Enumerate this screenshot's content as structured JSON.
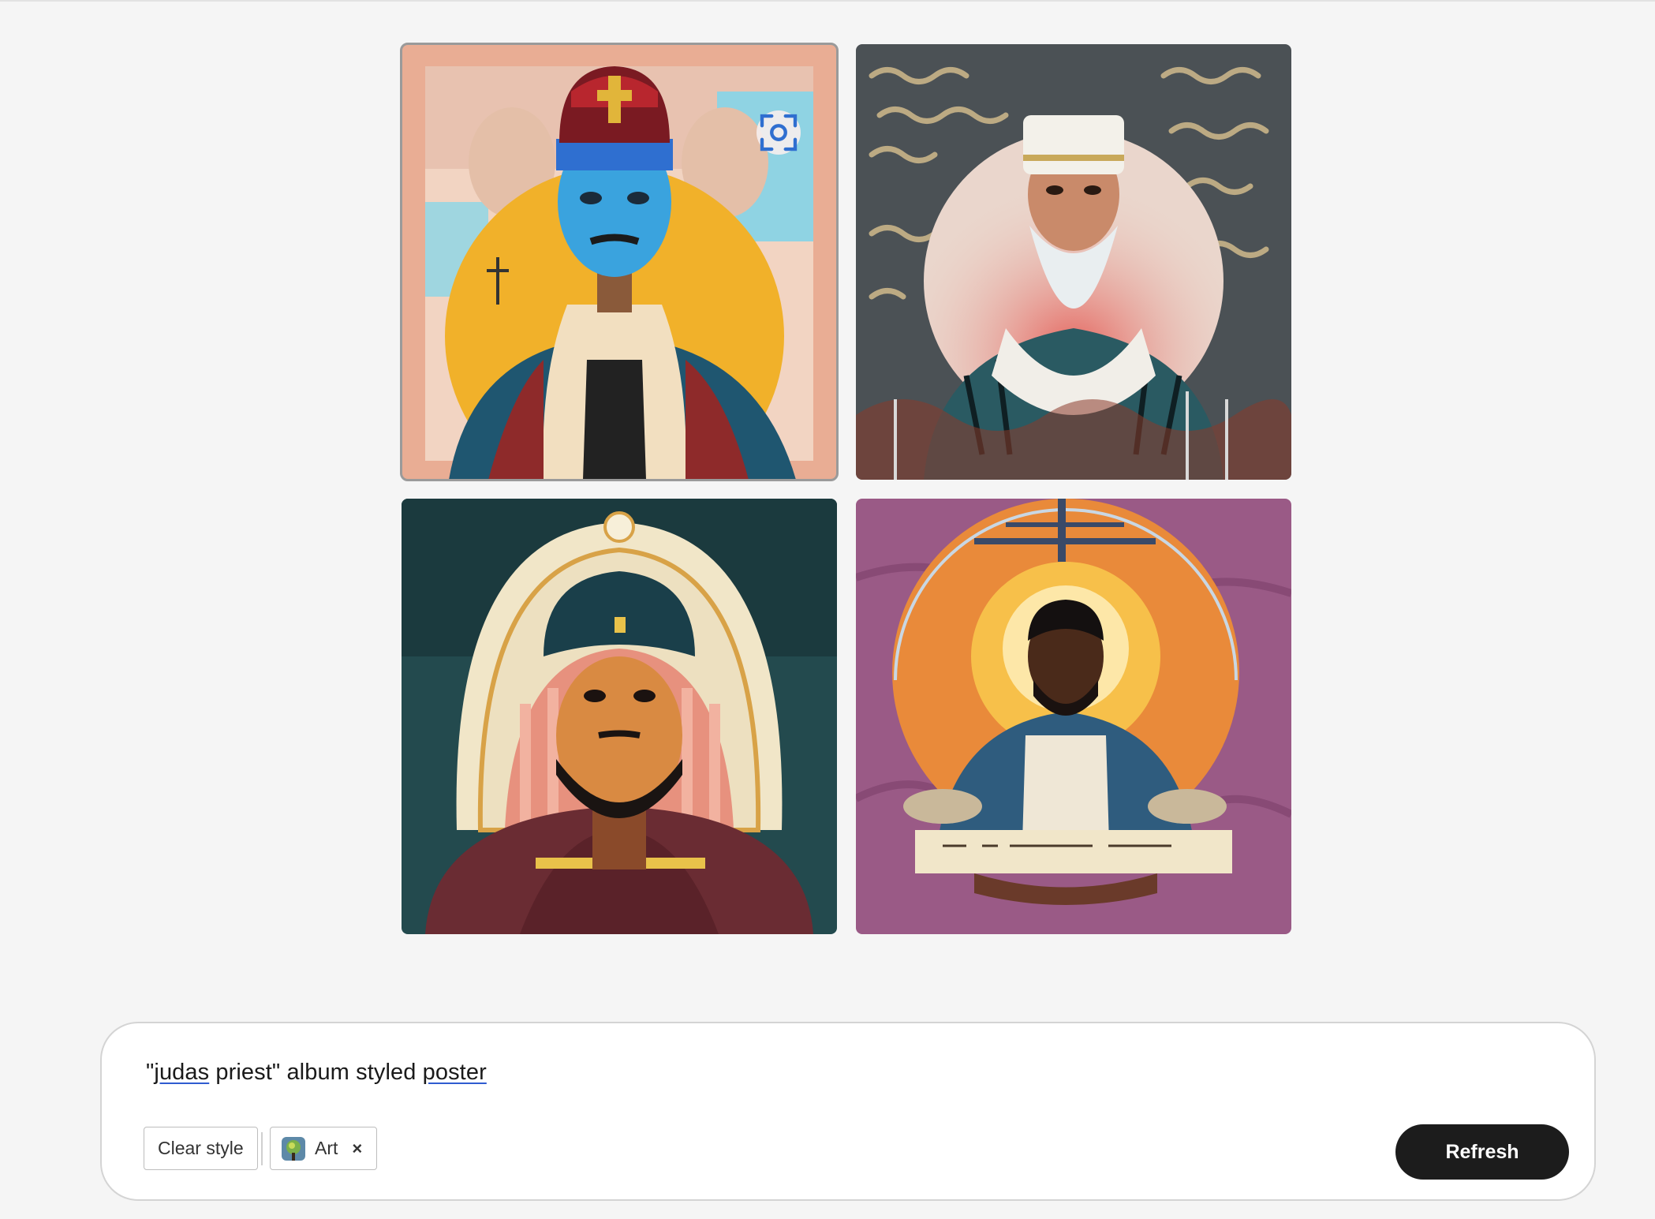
{
  "prompt": {
    "text_part1": "\"",
    "text_word1": "judas",
    "text_part2": " priest\" album styled ",
    "text_word2": "poster"
  },
  "controls": {
    "clear_style_label": "Clear style",
    "style_chip_label": "Art",
    "style_chip_remove": "×",
    "refresh_label": "Refresh"
  },
  "gallery": {
    "images": [
      {
        "name": "generated-image-1",
        "selected": true,
        "icon": "zoom-focus-icon"
      },
      {
        "name": "generated-image-2",
        "selected": false
      },
      {
        "name": "generated-image-3",
        "selected": false
      },
      {
        "name": "generated-image-4",
        "selected": false
      }
    ]
  },
  "colors": {
    "refresh_bg": "#1c1c1c",
    "underline": "#2f5bd0"
  }
}
